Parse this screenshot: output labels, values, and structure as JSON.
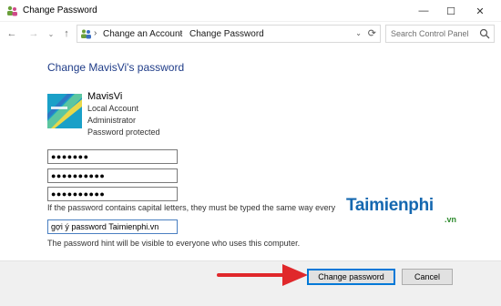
{
  "window": {
    "title": "Change Password",
    "controls": {
      "minimize": "—",
      "maximize": "☐",
      "close": "✕"
    }
  },
  "address": {
    "crumbs": [
      "Change an Account",
      "Change Password"
    ],
    "separator": "›",
    "search_placeholder": "Search Control Panel"
  },
  "main": {
    "heading": "Change MavisVi's password",
    "user": {
      "name": "MavisVi",
      "lines": [
        "Local Account",
        "Administrator",
        "Password protected"
      ]
    },
    "fields": {
      "current_password": "●●●●●●●",
      "new_password": "●●●●●●●●●●",
      "confirm_password": "●●●●●●●●●●",
      "hint": "gợi ý password Taimienphi.vn"
    },
    "note": "If the password contains capital letters, they must be typed the same way every",
    "hint_note": "The password hint will be visible to everyone who uses this computer."
  },
  "watermark": {
    "text": "Taimienphi",
    "sub": ".vn"
  },
  "buttons": {
    "primary": "Change password",
    "cancel": "Cancel"
  },
  "colors": {
    "accent": "#0078d7",
    "heading": "#1f3c88",
    "arrow": "#e0282b",
    "watermark": "#1568b0"
  }
}
